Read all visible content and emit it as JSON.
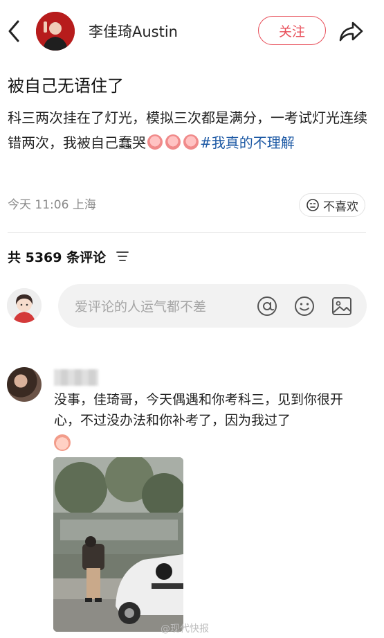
{
  "header": {
    "author_name": "李佳琦Austin",
    "follow_label": "关注"
  },
  "post": {
    "title": "被自己无语住了",
    "body_text": "科三两次挂在了灯光，模拟三次都是满分，一考试灯光连续错两次，我被自己蠢哭",
    "hashtag": "#我真的不理解",
    "time": "今天 11:06",
    "location": "上海",
    "dislike_label": "不喜欢"
  },
  "comments_section": {
    "count_label": "共 5369 条评论",
    "input_placeholder": "爱评论的人运气都不差"
  },
  "comment": {
    "text": "没事，佳琦哥，今天偶遇和你考科三，见到你很开心，不过没办法和你补考了，因为我过了"
  },
  "watermark": {
    "text": "@现代快报"
  },
  "colors": {
    "accent_red": "#e8505b",
    "hashtag_blue": "#1e5aa5",
    "meta_gray": "#8a8a8a"
  },
  "icons": {
    "back": "chevron-left-icon",
    "share": "share-arrow-icon",
    "dislike": "sad-face-icon",
    "sort": "sort-lines-icon",
    "mention": "at-sign-icon",
    "emoji": "smiley-icon",
    "image": "image-icon"
  }
}
